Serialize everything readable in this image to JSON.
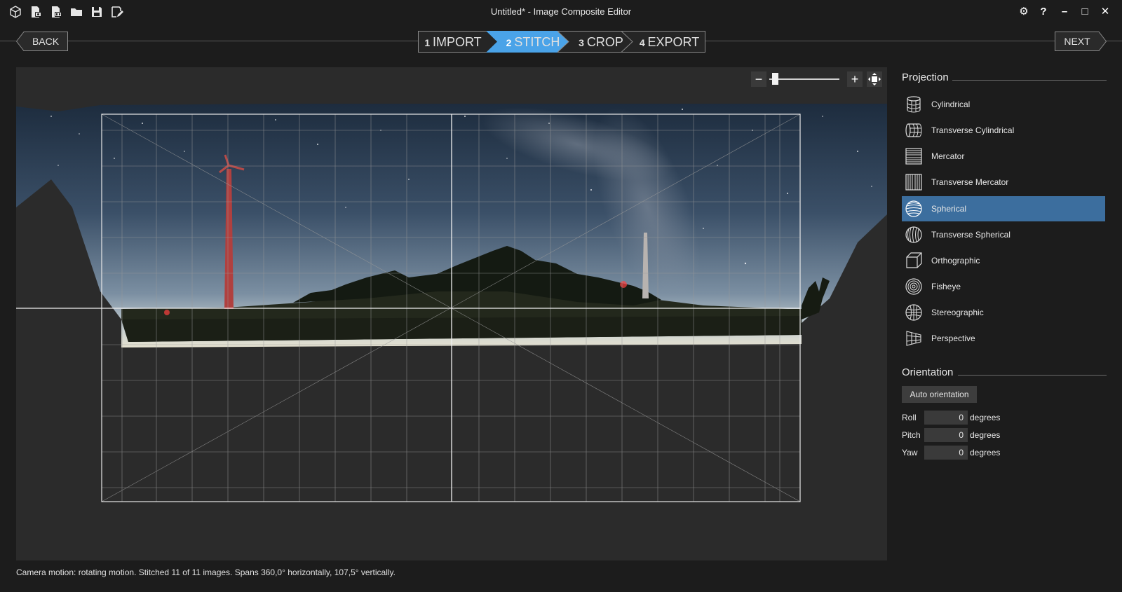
{
  "window": {
    "title": "Untitled* - Image Composite Editor",
    "toolbar_icons": [
      "new-project-icon",
      "new-from-images-icon",
      "new-from-video-icon",
      "open-icon",
      "save-icon",
      "save-as-icon"
    ],
    "window_controls": {
      "settings": "⚙",
      "help": "?",
      "minimize": "–",
      "maximize": "□",
      "close": "✕"
    }
  },
  "nav": {
    "back": "BACK",
    "next": "NEXT",
    "steps": [
      {
        "num": "1",
        "label": "IMPORT",
        "active": false
      },
      {
        "num": "2",
        "label": "STITCH",
        "active": true
      },
      {
        "num": "3",
        "label": "CROP",
        "active": false
      },
      {
        "num": "4",
        "label": "EXPORT",
        "active": false
      }
    ]
  },
  "zoom": {
    "minus": "−",
    "plus": "+",
    "level": 0.02
  },
  "projection": {
    "title": "Projection",
    "items": [
      {
        "label": "Cylindrical",
        "icon": "cylindrical-icon",
        "selected": false
      },
      {
        "label": "Transverse Cylindrical",
        "icon": "transverse-cylindrical-icon",
        "selected": false
      },
      {
        "label": "Mercator",
        "icon": "mercator-icon",
        "selected": false
      },
      {
        "label": "Transverse Mercator",
        "icon": "transverse-mercator-icon",
        "selected": false
      },
      {
        "label": "Spherical",
        "icon": "spherical-icon",
        "selected": true
      },
      {
        "label": "Transverse Spherical",
        "icon": "transverse-spherical-icon",
        "selected": false
      },
      {
        "label": "Orthographic",
        "icon": "orthographic-icon",
        "selected": false
      },
      {
        "label": "Fisheye",
        "icon": "fisheye-icon",
        "selected": false
      },
      {
        "label": "Stereographic",
        "icon": "stereographic-icon",
        "selected": false
      },
      {
        "label": "Perspective",
        "icon": "perspective-icon",
        "selected": false
      }
    ]
  },
  "orientation": {
    "title": "Orientation",
    "auto_button": "Auto orientation",
    "roll": {
      "label": "Roll",
      "value": "0",
      "unit": "degrees"
    },
    "pitch": {
      "label": "Pitch",
      "value": "0",
      "unit": "degrees"
    },
    "yaw": {
      "label": "Yaw",
      "value": "0",
      "unit": "degrees"
    }
  },
  "status": "Camera motion: rotating motion. Stitched 11 of 11 images. Spans 360,0° horizontally, 107,5° vertically.",
  "colors": {
    "accent": "#4aa3e8",
    "selected_row": "#3c6e9e",
    "background": "#1c1c1c",
    "panel": "#2b2b2b"
  }
}
